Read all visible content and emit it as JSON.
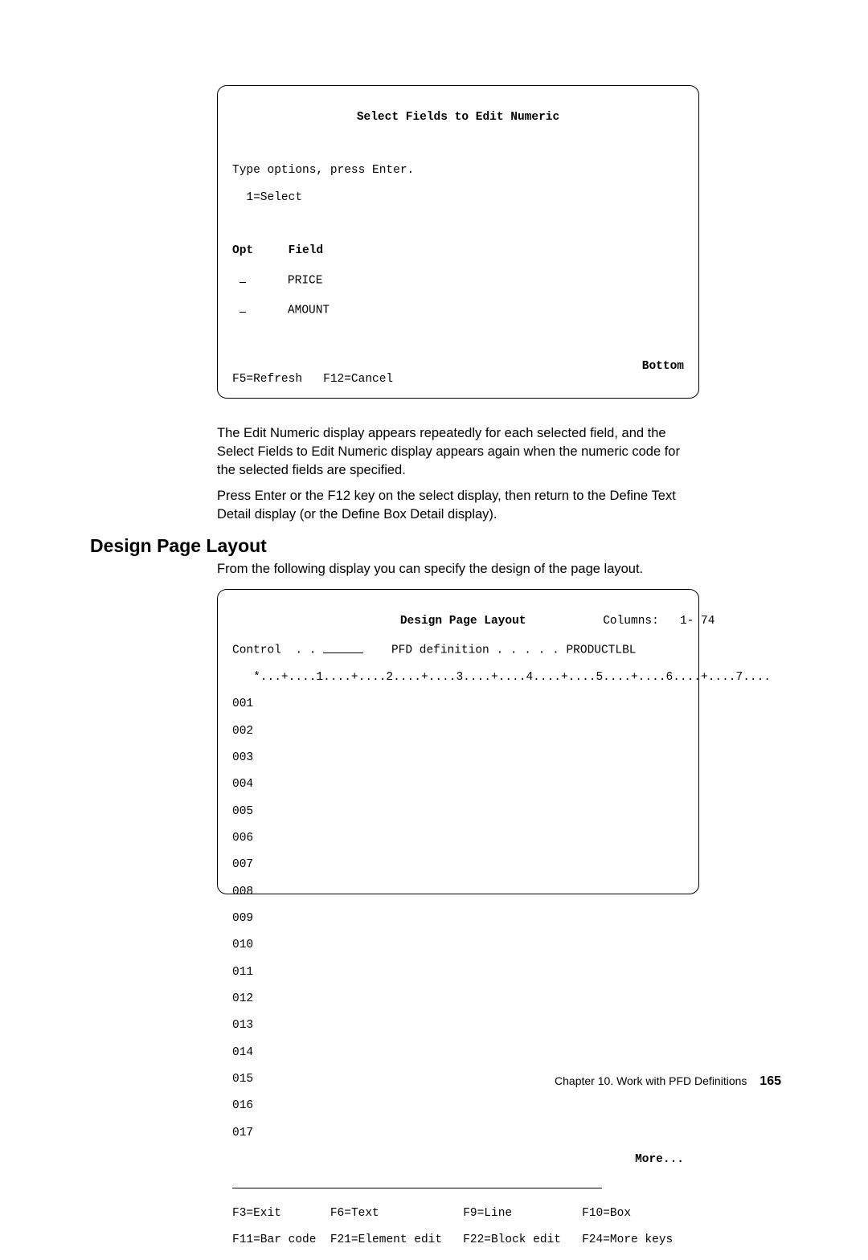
{
  "terminal1": {
    "title": "Select Fields to Edit Numeric",
    "instructions_l1": "Type options, press Enter.",
    "instructions_l2": "  1=Select",
    "header_opt": "Opt",
    "header_field": "Field",
    "row1_field": "PRICE",
    "row2_field": "AMOUNT",
    "bottom_label": "Bottom",
    "fkeys": "F5=Refresh   F12=Cancel"
  },
  "para1": "The Edit Numeric display appears repeatedly for each selected field, and the Select Fields to Edit Numeric display appears again when the numeric code for the selected fields are specified.",
  "para2": "Press Enter or the F12 key on the select display, then return to the Define Text Detail display (or the Define Box Detail display).",
  "heading": "Design Page Layout",
  "para3": "From the following display you can specify the design of the page layout.",
  "terminal2": {
    "title": "Design Page Layout",
    "columns_label": "Columns:",
    "columns_value": "1- 74",
    "control_label": "Control  . .",
    "pfd_label": "PFD definition . . . . . PRODUCTLBL",
    "ruler": "   *...+....1....+....2....+....3....+....4....+....5....+....6....+....7....",
    "lines": [
      "001",
      "002",
      "003",
      "004",
      "005",
      "006",
      "007",
      "008",
      "009",
      "010",
      "011",
      "012",
      "013",
      "014",
      "015",
      "016",
      "017"
    ],
    "more_label": "More...",
    "fkeys_l1_c1": "F3=Exit",
    "fkeys_l1_c2": "F6=Text",
    "fkeys_l1_c3": "F9=Line",
    "fkeys_l1_c4": "F10=Box",
    "fkeys_l2_c1": "F11=Bar code",
    "fkeys_l2_c2": "F21=Element edit",
    "fkeys_l2_c3": "F22=Block edit",
    "fkeys_l2_c4": "F24=More keys"
  },
  "footer": {
    "chapter": "Chapter 10.  Work with PFD Definitions",
    "page": "165"
  }
}
